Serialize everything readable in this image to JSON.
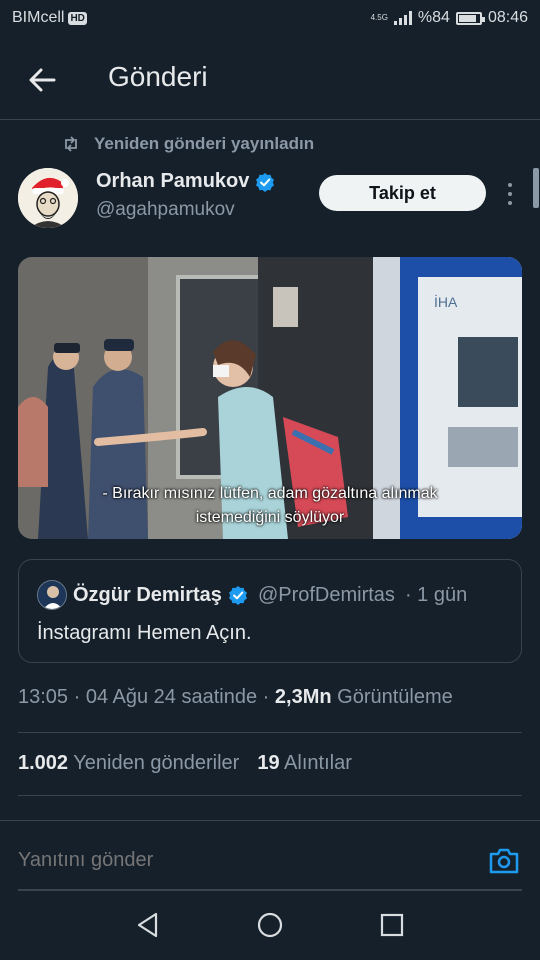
{
  "status_bar": {
    "carrier": "BIMcell",
    "carrier_badge": "HD",
    "network": "4.5G",
    "battery_level": "%84",
    "time": "08:46"
  },
  "header": {
    "title": "Gönderi",
    "back_icon": "arrow-left-icon"
  },
  "post": {
    "repost_note": "Yeniden gönderi yayınladın",
    "author_name": "Orhan Pamukov",
    "author_handle": "@agahpamukov",
    "verified": true,
    "follow_label": "Takip et",
    "media": {
      "caption_line1": "- Bırakır mısınız lütfen, adam gözaltına alınmak",
      "caption_line2": "istemediğini söylüyor",
      "watermark": "İHA"
    },
    "quoted": {
      "author_name": "Özgür Demirtaş",
      "author_handle": "@ProfDemirtas",
      "time_ago": "· 1 gün",
      "text": "İnstagramı Hemen Açın."
    },
    "meta": {
      "time": "13:05",
      "date": "· 04 Ağu 24 saatinde ·",
      "views_value": "2,3Mn",
      "views_label": "Görüntüleme"
    },
    "stats": {
      "reposts_value": "1.002",
      "reposts_label": "Yeniden gönderiler",
      "quotes_value": "19",
      "quotes_label": "Alıntılar"
    }
  },
  "reply": {
    "placeholder": "Yanıtını gönder",
    "camera_icon": "camera-icon"
  },
  "colors": {
    "background": "#15202b",
    "accent": "#1d9bf0",
    "text_secondary": "#8b98a5",
    "border": "#38444d"
  }
}
